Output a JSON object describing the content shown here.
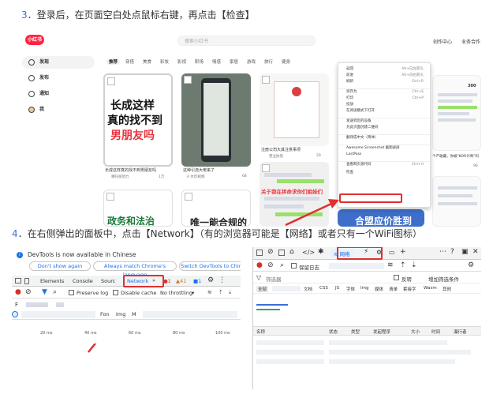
{
  "step3": {
    "number": "3",
    "text": "．登录后，在页面空白处点鼠标右键，再点击【检查】"
  },
  "step4": {
    "number": "4",
    "text": "．在右侧弹出的面板中，点击【Network】（有的浏览器可能是【网络】或者只有一个WiFi图标）"
  },
  "xhs": {
    "logo": "小红书",
    "search_placeholder": "搜索小红书",
    "top_links": [
      "创作中心",
      "业务合作"
    ],
    "sidebar": [
      "发现",
      "发布",
      "通知",
      "我"
    ],
    "categories": [
      "推荐",
      "穿搭",
      "美食",
      "彩妆",
      "影视",
      "职场",
      "情感",
      "家居",
      "游戏",
      "旅行",
      "健身"
    ],
    "card1": {
      "line1": "长成这样",
      "line2": "真的找不到",
      "line3": "男朋友吗",
      "title": "长成这样真的找不到男朋友吗",
      "author": "哪吒很努力",
      "likes": "1万"
    },
    "card2": {
      "title": "这种引流大佬来了",
      "author": "A 水印视频",
      "likes": "68"
    },
    "card3": {
      "title": "注册公司大其注意事项",
      "author": "营业执照",
      "likes": "29"
    },
    "card4": {
      "overlay": "关于我在拼命求你们姐妹们"
    },
    "card5": {
      "line1": "政务和法治",
      "line2": "唯一能合规的"
    },
    "card6": {
      "line1": "合盟应价胜到"
    },
    "right_cards": {
      "num": "300",
      "title1": "个产收藏，你被“KOR计奇”吗",
      "title2": "全店了",
      "likes": "96",
      "likes2": "36"
    },
    "context_menu": {
      "items": [
        {
          "label": "返回",
          "shortcut": "Alt+向左箭头"
        },
        {
          "label": "前进",
          "shortcut": "Alt+向右箭头"
        },
        {
          "label": "刷新",
          "shortcut": "Ctrl+R"
        },
        {
          "label": "另存为",
          "shortcut": "Ctrl+S"
        },
        {
          "label": "打印",
          "shortcut": "Ctrl+P"
        },
        {
          "label": "投放",
          "shortcut": ""
        },
        {
          "label": "在阅读模式下打开",
          "shortcut": ""
        },
        {
          "label": "发送到您的设备",
          "shortcut": ""
        },
        {
          "label": "为此页面创建二维码",
          "shortcut": ""
        },
        {
          "label": "翻译成中文（简体）",
          "shortcut": ""
        },
        {
          "label": "Awesome Screenshot 截图录屏",
          "shortcut": ""
        },
        {
          "label": "LastPass",
          "shortcut": ""
        },
        {
          "label": "查看网页源代码",
          "shortcut": "Ctrl+U"
        },
        {
          "label": "检查",
          "shortcut": ""
        }
      ]
    }
  },
  "devtools_en": {
    "banner": "DevTools is now available in Chinese",
    "btn_dont_show": "Don't show again",
    "btn_match": "Always match Chrome's language",
    "btn_switch": "Switch DevTools to Chin",
    "tabs": [
      "Elements",
      "Console",
      "Sourc",
      "Network"
    ],
    "more_tabs": "»",
    "badge_errors": "1",
    "badge_warnings": "41",
    "badge_info": "1",
    "preserve_log": "Preserve log",
    "disable_cache": "Disable cache",
    "throttling": "No throttling",
    "filter_types": [
      "Fon",
      "Img",
      "M"
    ],
    "ticks": [
      "20 ms",
      "40 ms",
      "60 ms",
      "80 ms",
      "100 ms"
    ]
  },
  "devtools_zh": {
    "network_tab": "网络",
    "filter_placeholder": "筛选器",
    "preserve_log": "保留日志",
    "invert": "反转",
    "hide_ext": "增加筛选条件",
    "types": [
      "全部",
      "文档",
      "CSS",
      "JS",
      "字体",
      "Img",
      "媒体",
      "清单",
      "套接字",
      "Wasm",
      "其他"
    ],
    "columns": [
      "名称",
      "状态",
      "类型",
      "发起程序",
      "大小",
      "时间",
      "瀑行者"
    ]
  },
  "colors": {
    "brand_red": "#ff2442",
    "annotation_red": "#e03030",
    "step_blue": "#3a6fd8",
    "link_blue": "#1a73e8"
  }
}
